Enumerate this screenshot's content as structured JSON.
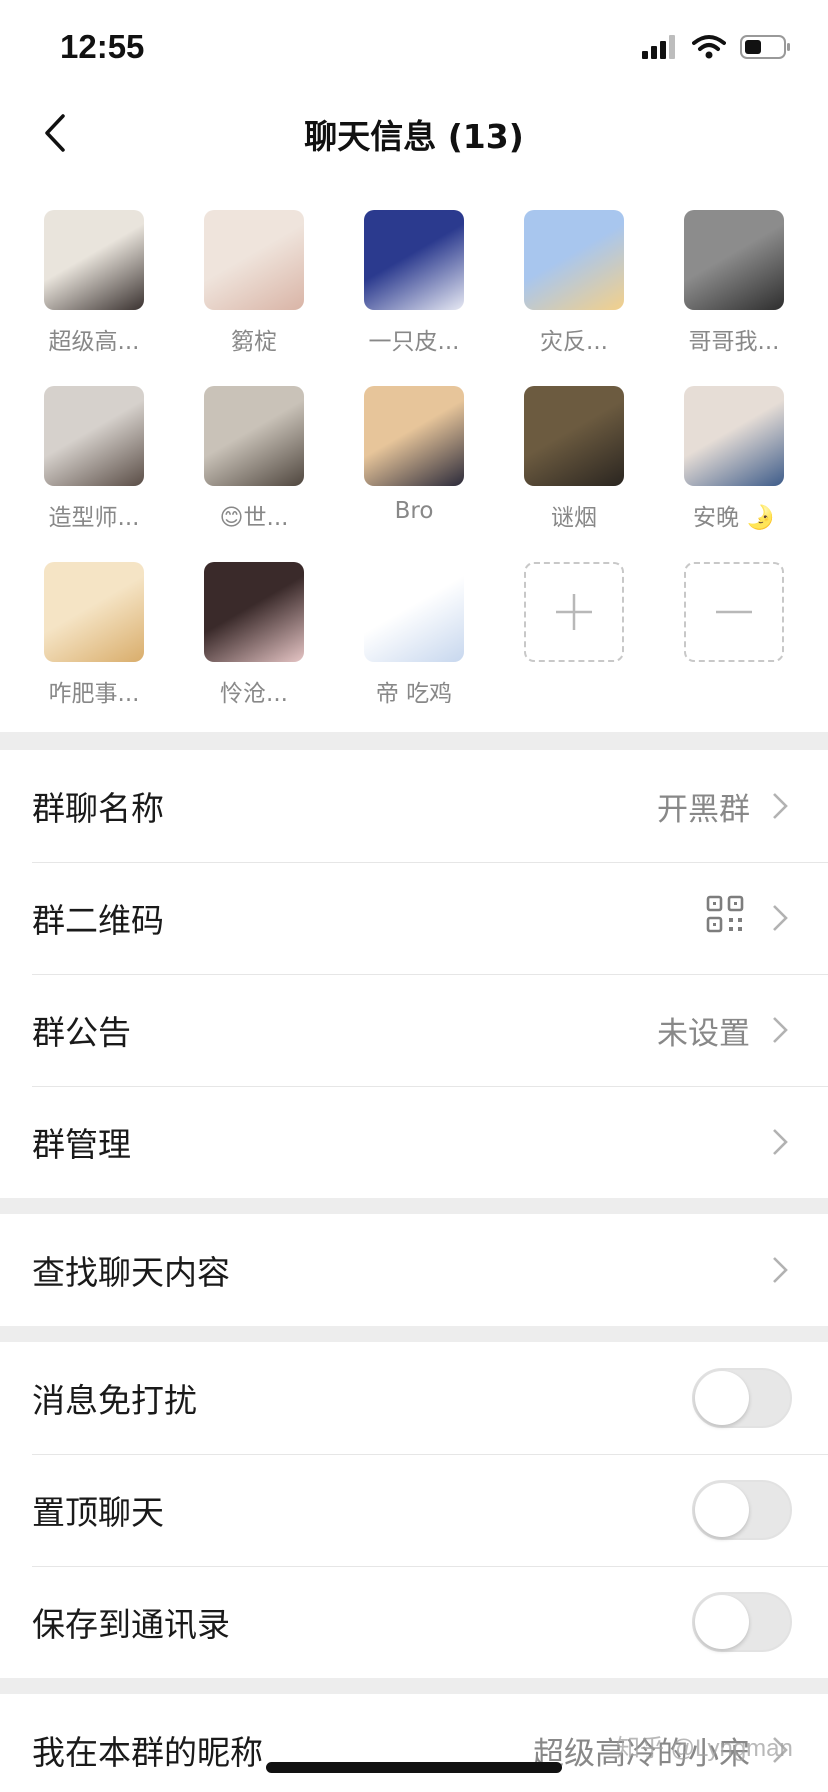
{
  "status_bar": {
    "time": "12:55"
  },
  "nav": {
    "title": "聊天信息 (13)"
  },
  "members": [
    {
      "name": "超级高...",
      "colors": [
        "#e9e4dc",
        "#3a3230"
      ]
    },
    {
      "name": "篘椗",
      "colors": [
        "#efe4dc",
        "#d9b4a6"
      ]
    },
    {
      "name": "一只皮...",
      "colors": [
        "#2b3a8e",
        "#e7e9f3"
      ]
    },
    {
      "name": "灾反...",
      "colors": [
        "#a8c6ee",
        "#f3d08a"
      ]
    },
    {
      "name": "哥哥我...",
      "colors": [
        "#8c8c8c",
        "#2e2e2e"
      ]
    },
    {
      "name": "造型师...",
      "colors": [
        "#d6d1cc",
        "#5a4d46"
      ]
    },
    {
      "name": "😊世...",
      "colors": [
        "#c9c2b8",
        "#4f463e"
      ]
    },
    {
      "name": "Bro",
      "colors": [
        "#e7c59a",
        "#2b2a3a"
      ]
    },
    {
      "name": "谜烟",
      "colors": [
        "#6c5b40",
        "#2a2520"
      ]
    },
    {
      "name": "安晚 🌛",
      "colors": [
        "#e6ddd6",
        "#3e5c8a"
      ]
    },
    {
      "name": "咋肥事...",
      "colors": [
        "#f5e4c5",
        "#d9ad6b"
      ]
    },
    {
      "name": "怜沧...",
      "colors": [
        "#3a2a2a",
        "#e6c5c5"
      ]
    },
    {
      "name": "帝 吃鸡",
      "colors": [
        "#ffffff",
        "#c7d7ee"
      ]
    }
  ],
  "section1": {
    "group_name_label": "群聊名称",
    "group_name_value": "开黑群",
    "qr_label": "群二维码",
    "notice_label": "群公告",
    "notice_value": "未设置",
    "manage_label": "群管理"
  },
  "section2": {
    "search_label": "查找聊天内容"
  },
  "section3": {
    "mute_label": "消息免打扰",
    "mute_on": false,
    "pin_label": "置顶聊天",
    "pin_on": false,
    "save_label": "保存到通讯录",
    "save_on": false
  },
  "section4": {
    "nickname_label": "我在本群的昵称",
    "nickname_value": "超级高冷的小宋"
  },
  "watermark": "知乎 @Lyngman"
}
